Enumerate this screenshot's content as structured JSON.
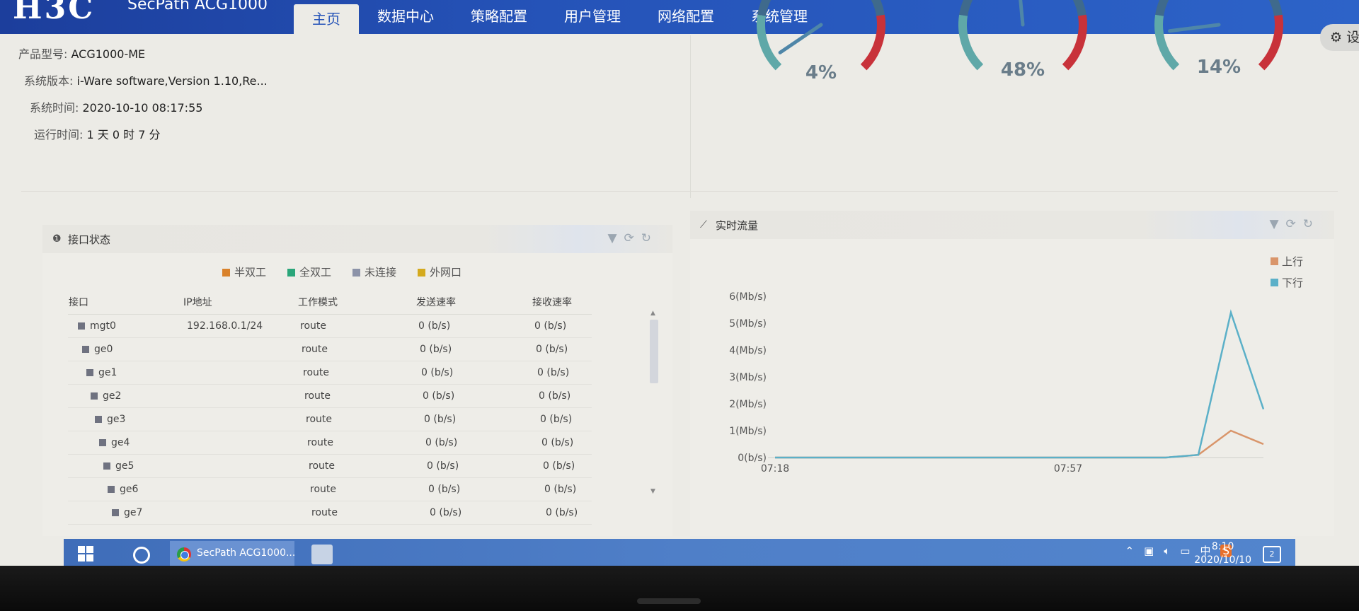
{
  "header": {
    "logo": "H3C",
    "product": "SecPath ACG1000",
    "nav": [
      "主页",
      "数据中心",
      "策略配置",
      "用户管理",
      "网络配置",
      "系统管理"
    ],
    "settings_label": "设"
  },
  "info": {
    "model_label": "产品型号:",
    "model": "ACG1000-ME",
    "version_label": "系统版本:",
    "version": "i-Ware software,Version 1.10,Re...",
    "time_label": "系统时间:",
    "time": "2020-10-10 08:17:55",
    "uptime_label": "运行时间:",
    "uptime": "1 天 0 时 7 分"
  },
  "gauges": [
    {
      "value": "4%",
      "level": 0.04
    },
    {
      "value": "48%",
      "level": 0.48
    },
    {
      "value": "14%",
      "level": 0.14
    }
  ],
  "interface_panel": {
    "title": "接口状态",
    "legend": [
      {
        "label": "半双工",
        "color": "#d9822b"
      },
      {
        "label": "全双工",
        "color": "#2aa67a"
      },
      {
        "label": "未连接",
        "color": "#8c93a8"
      },
      {
        "label": "外网口",
        "color": "#d4aa1e"
      }
    ],
    "columns": [
      "接口",
      "IP地址",
      "工作模式",
      "发送速率",
      "接收速率"
    ],
    "rows": [
      {
        "name": "mgt0",
        "ip": "192.168.0.1/24",
        "mode": "route",
        "tx": "0 (b/s)",
        "rx": "0 (b/s)"
      },
      {
        "name": "ge0",
        "ip": "",
        "mode": "route",
        "tx": "0 (b/s)",
        "rx": "0 (b/s)"
      },
      {
        "name": "ge1",
        "ip": "",
        "mode": "route",
        "tx": "0 (b/s)",
        "rx": "0 (b/s)"
      },
      {
        "name": "ge2",
        "ip": "",
        "mode": "route",
        "tx": "0 (b/s)",
        "rx": "0 (b/s)"
      },
      {
        "name": "ge3",
        "ip": "",
        "mode": "route",
        "tx": "0 (b/s)",
        "rx": "0 (b/s)"
      },
      {
        "name": "ge4",
        "ip": "",
        "mode": "route",
        "tx": "0 (b/s)",
        "rx": "0 (b/s)"
      },
      {
        "name": "ge5",
        "ip": "",
        "mode": "route",
        "tx": "0 (b/s)",
        "rx": "0 (b/s)"
      },
      {
        "name": "ge6",
        "ip": "",
        "mode": "route",
        "tx": "0 (b/s)",
        "rx": "0 (b/s)"
      },
      {
        "name": "ge7",
        "ip": "",
        "mode": "route",
        "tx": "0 (b/s)",
        "rx": "0 (b/s)"
      }
    ]
  },
  "traffic_panel": {
    "title": "实时流量",
    "tools": "▼ ⟳ ↻"
  },
  "chart_data": {
    "type": "line",
    "title": "实时流量",
    "y_tick_labels": [
      "0(b/s)",
      "1(Mb/s)",
      "2(Mb/s)",
      "3(Mb/s)",
      "4(Mb/s)",
      "5(Mb/s)",
      "6(Mb/s)"
    ],
    "ylim": [
      0,
      6
    ],
    "x_tick_labels": [
      "07:18",
      "07:57"
    ],
    "x": [
      0,
      1,
      2,
      3,
      4,
      5,
      6,
      7,
      8,
      9,
      10,
      11,
      12,
      13,
      14,
      15
    ],
    "series": [
      {
        "name": "上行",
        "color": "#d9956a",
        "values": [
          0,
          0,
          0,
          0,
          0,
          0,
          0,
          0,
          0,
          0,
          0,
          0,
          0,
          0.1,
          1.0,
          0.5
        ]
      },
      {
        "name": "下行",
        "color": "#5bb0c8",
        "values": [
          0,
          0,
          0,
          0,
          0,
          0,
          0,
          0,
          0,
          0,
          0,
          0,
          0,
          0.1,
          5.4,
          1.8
        ]
      }
    ],
    "legend": "top-right",
    "grid": false
  },
  "taskbar": {
    "app_label": "SecPath ACG1000...",
    "tray_lang": "中",
    "clock_time": "8:10",
    "clock_date": "2020/10/10",
    "notif_count": "2"
  }
}
